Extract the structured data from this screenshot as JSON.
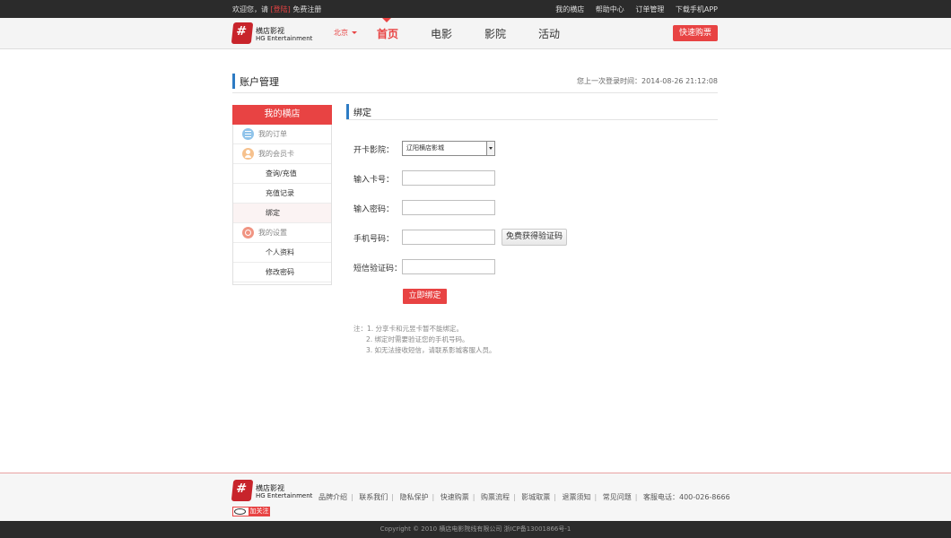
{
  "topbar": {
    "welcome": "欢迎您，请",
    "login": "[登陆]",
    "register": "免费注册",
    "links": [
      "我的横店",
      "帮助中心",
      "订单管理",
      "下载手机APP"
    ]
  },
  "header": {
    "logo_cn": "横店影视",
    "logo_en": "HG Entertainment",
    "city": "北京",
    "nav": [
      "首页",
      "电影",
      "影院",
      "活动"
    ],
    "active_nav": "首页",
    "quick_buy": "快速购票"
  },
  "page": {
    "title": "账户管理",
    "last_login": "您上一次登录时间：2014-08-26 21:12:08"
  },
  "sidebar": {
    "head": "我的横店",
    "sections": [
      {
        "label": "我的订单",
        "icon": "orders-icon"
      },
      {
        "label": "我的会员卡",
        "icon": "member-card-icon"
      },
      {
        "label": "我的设置",
        "icon": "settings-icon"
      }
    ],
    "card_items": [
      "查询/充值",
      "充值记录",
      "绑定"
    ],
    "settings_items": [
      "个人资料",
      "修改密码"
    ],
    "active_item": "绑定"
  },
  "content": {
    "title": "绑定",
    "cinema_label": "开卡影院：",
    "cinema_value": "辽阳横店影城",
    "card_label": "输入卡号：",
    "card_value": "",
    "password_label": "输入密码：",
    "password_value": "",
    "phone_label": "手机号码：",
    "phone_value": "",
    "sms_button": "免费获得验证码",
    "code_label": "短信验证码：",
    "code_value": "",
    "submit": "立即绑定",
    "notes": [
      "注：1. 分享卡和元昱卡暂不能绑定。",
      "2. 绑定时需要验证您的手机号码。",
      "3. 如无法接收短信，请联系影城客服人员。"
    ]
  },
  "footer": {
    "logo_cn": "横店影视",
    "logo_en": "HG Entertainment",
    "links": [
      "品牌介绍",
      "联系我们",
      "隐私保护",
      "快速购票",
      "购票流程",
      "影城取票",
      "退票须知",
      "常见问题"
    ],
    "hotline": "客服电话：400-026-8666",
    "follow": "加关注",
    "copyright": "Copyright © 2010 横店电影院线有限公司 浙ICP备13001866号-1"
  },
  "colors": {
    "accent": "#e84343",
    "title_bar": "#2d7bc4",
    "dark_bar": "#2b2b2b"
  }
}
